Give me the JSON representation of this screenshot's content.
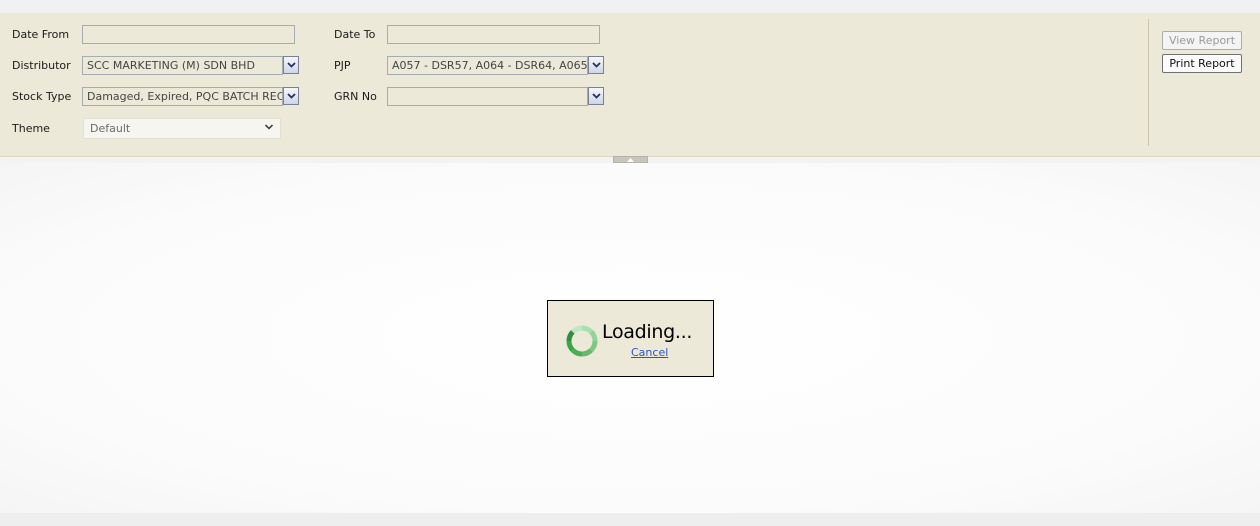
{
  "params": {
    "date_from": {
      "label": "Date From",
      "value": ""
    },
    "date_to": {
      "label": "Date To",
      "value": ""
    },
    "distributor": {
      "label": "Distributor",
      "value": "SCC MARKETING (M) SDN BHD"
    },
    "pjp": {
      "label": "PJP",
      "value": "A057 - DSR57, A064 - DSR64, A065"
    },
    "stock_type": {
      "label": "Stock Type",
      "value": "Damaged, Expired, PQC BATCH REC"
    },
    "grn_no": {
      "label": "GRN No",
      "value": ""
    },
    "theme": {
      "label": "Theme",
      "value": "Default"
    }
  },
  "toolbar": {
    "view_report": "View Report",
    "print_report": "Print Report"
  },
  "loading": {
    "text": "Loading...",
    "cancel": "Cancel"
  },
  "colors": {
    "panel_bg": "#ece9d8",
    "link": "#2f54c6",
    "spinner": "#3aa64a"
  },
  "icons": {
    "dropdown": "chevron-down-icon",
    "collapse": "chevron-up-icon",
    "spinner": "spinner-icon"
  }
}
